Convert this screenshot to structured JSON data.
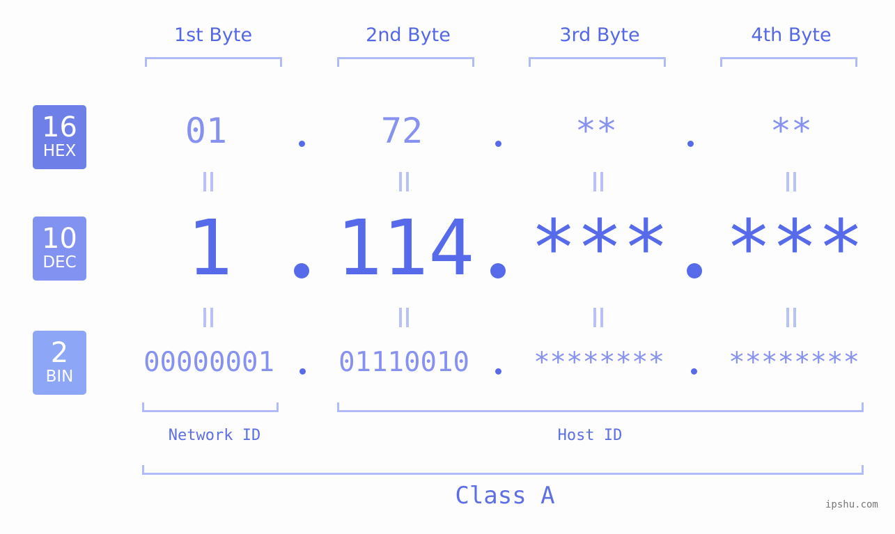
{
  "header": {
    "bytes": [
      "1st Byte",
      "2nd Byte",
      "3rd Byte",
      "4th Byte"
    ]
  },
  "badges": {
    "hex": {
      "base": "16",
      "label": "HEX",
      "color": "#6e7fe8"
    },
    "dec": {
      "base": "10",
      "label": "DEC",
      "color": "#8192f0"
    },
    "bin": {
      "base": "2",
      "label": "BIN",
      "color": "#8ea6f6"
    }
  },
  "hex": [
    "01",
    "72",
    "**",
    "**"
  ],
  "dec": [
    "1",
    "114",
    "***",
    "***"
  ],
  "bin": [
    "00000001",
    "01110010",
    "********",
    "********"
  ],
  "separator": ".",
  "equals": "=",
  "segments": {
    "network": "Network ID",
    "host": "Host ID",
    "class": "Class A"
  },
  "watermark": "ipshu.com",
  "colors": {
    "accent": "#576bea",
    "muted": "#8792f0",
    "bracket": "#b1bbf7",
    "background": "#fcfdfc"
  }
}
